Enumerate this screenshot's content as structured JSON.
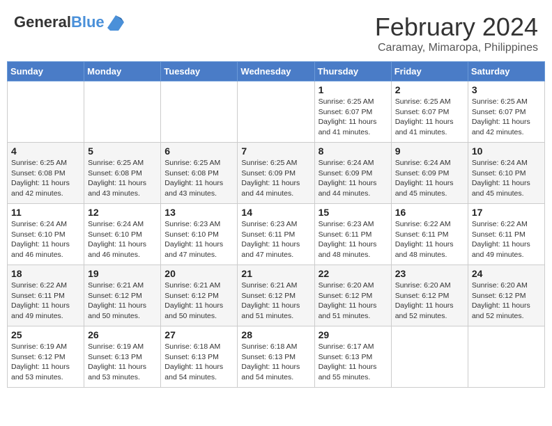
{
  "header": {
    "logo_general": "General",
    "logo_blue": "Blue",
    "title": "February 2024",
    "subtitle": "Caramay, Mimaropa, Philippines"
  },
  "days_of_week": [
    "Sunday",
    "Monday",
    "Tuesday",
    "Wednesday",
    "Thursday",
    "Friday",
    "Saturday"
  ],
  "weeks": [
    [
      {
        "day": "",
        "info": ""
      },
      {
        "day": "",
        "info": ""
      },
      {
        "day": "",
        "info": ""
      },
      {
        "day": "",
        "info": ""
      },
      {
        "day": "1",
        "info": "Sunrise: 6:25 AM\nSunset: 6:07 PM\nDaylight: 11 hours and 41 minutes."
      },
      {
        "day": "2",
        "info": "Sunrise: 6:25 AM\nSunset: 6:07 PM\nDaylight: 11 hours and 41 minutes."
      },
      {
        "day": "3",
        "info": "Sunrise: 6:25 AM\nSunset: 6:07 PM\nDaylight: 11 hours and 42 minutes."
      }
    ],
    [
      {
        "day": "4",
        "info": "Sunrise: 6:25 AM\nSunset: 6:08 PM\nDaylight: 11 hours and 42 minutes."
      },
      {
        "day": "5",
        "info": "Sunrise: 6:25 AM\nSunset: 6:08 PM\nDaylight: 11 hours and 43 minutes."
      },
      {
        "day": "6",
        "info": "Sunrise: 6:25 AM\nSunset: 6:08 PM\nDaylight: 11 hours and 43 minutes."
      },
      {
        "day": "7",
        "info": "Sunrise: 6:25 AM\nSunset: 6:09 PM\nDaylight: 11 hours and 44 minutes."
      },
      {
        "day": "8",
        "info": "Sunrise: 6:24 AM\nSunset: 6:09 PM\nDaylight: 11 hours and 44 minutes."
      },
      {
        "day": "9",
        "info": "Sunrise: 6:24 AM\nSunset: 6:09 PM\nDaylight: 11 hours and 45 minutes."
      },
      {
        "day": "10",
        "info": "Sunrise: 6:24 AM\nSunset: 6:10 PM\nDaylight: 11 hours and 45 minutes."
      }
    ],
    [
      {
        "day": "11",
        "info": "Sunrise: 6:24 AM\nSunset: 6:10 PM\nDaylight: 11 hours and 46 minutes."
      },
      {
        "day": "12",
        "info": "Sunrise: 6:24 AM\nSunset: 6:10 PM\nDaylight: 11 hours and 46 minutes."
      },
      {
        "day": "13",
        "info": "Sunrise: 6:23 AM\nSunset: 6:10 PM\nDaylight: 11 hours and 47 minutes."
      },
      {
        "day": "14",
        "info": "Sunrise: 6:23 AM\nSunset: 6:11 PM\nDaylight: 11 hours and 47 minutes."
      },
      {
        "day": "15",
        "info": "Sunrise: 6:23 AM\nSunset: 6:11 PM\nDaylight: 11 hours and 48 minutes."
      },
      {
        "day": "16",
        "info": "Sunrise: 6:22 AM\nSunset: 6:11 PM\nDaylight: 11 hours and 48 minutes."
      },
      {
        "day": "17",
        "info": "Sunrise: 6:22 AM\nSunset: 6:11 PM\nDaylight: 11 hours and 49 minutes."
      }
    ],
    [
      {
        "day": "18",
        "info": "Sunrise: 6:22 AM\nSunset: 6:11 PM\nDaylight: 11 hours and 49 minutes."
      },
      {
        "day": "19",
        "info": "Sunrise: 6:21 AM\nSunset: 6:12 PM\nDaylight: 11 hours and 50 minutes."
      },
      {
        "day": "20",
        "info": "Sunrise: 6:21 AM\nSunset: 6:12 PM\nDaylight: 11 hours and 50 minutes."
      },
      {
        "day": "21",
        "info": "Sunrise: 6:21 AM\nSunset: 6:12 PM\nDaylight: 11 hours and 51 minutes."
      },
      {
        "day": "22",
        "info": "Sunrise: 6:20 AM\nSunset: 6:12 PM\nDaylight: 11 hours and 51 minutes."
      },
      {
        "day": "23",
        "info": "Sunrise: 6:20 AM\nSunset: 6:12 PM\nDaylight: 11 hours and 52 minutes."
      },
      {
        "day": "24",
        "info": "Sunrise: 6:20 AM\nSunset: 6:12 PM\nDaylight: 11 hours and 52 minutes."
      }
    ],
    [
      {
        "day": "25",
        "info": "Sunrise: 6:19 AM\nSunset: 6:12 PM\nDaylight: 11 hours and 53 minutes."
      },
      {
        "day": "26",
        "info": "Sunrise: 6:19 AM\nSunset: 6:13 PM\nDaylight: 11 hours and 53 minutes."
      },
      {
        "day": "27",
        "info": "Sunrise: 6:18 AM\nSunset: 6:13 PM\nDaylight: 11 hours and 54 minutes."
      },
      {
        "day": "28",
        "info": "Sunrise: 6:18 AM\nSunset: 6:13 PM\nDaylight: 11 hours and 54 minutes."
      },
      {
        "day": "29",
        "info": "Sunrise: 6:17 AM\nSunset: 6:13 PM\nDaylight: 11 hours and 55 minutes."
      },
      {
        "day": "",
        "info": ""
      },
      {
        "day": "",
        "info": ""
      }
    ]
  ]
}
